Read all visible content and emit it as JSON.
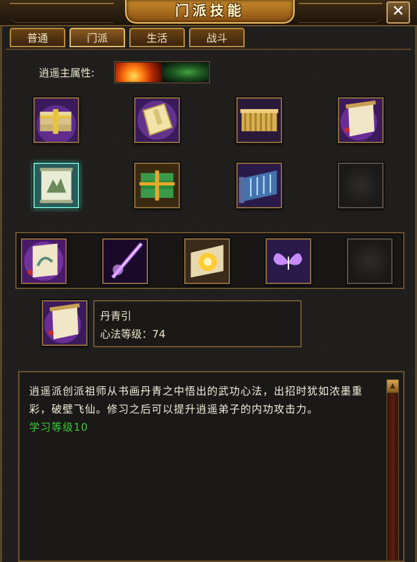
{
  "window": {
    "title": "门派技能",
    "close_label": "✕"
  },
  "tabs": [
    {
      "label": "普通",
      "active": false
    },
    {
      "label": "门派",
      "active": true
    },
    {
      "label": "生活",
      "active": false
    },
    {
      "label": "战斗",
      "active": false
    }
  ],
  "attribute": {
    "label": "逍遥主属性:",
    "icons": [
      "fire-attribute-icon",
      "wind-attribute-icon"
    ]
  },
  "skill_grid": [
    {
      "icon": "bound-books-icon"
    },
    {
      "icon": "manual-book-icon"
    },
    {
      "icon": "golden-scrolls-icon"
    },
    {
      "icon": "hanging-scroll-icon"
    },
    {
      "icon": "landscape-scroll-icon",
      "selected": true
    },
    {
      "icon": "treasure-books-icon"
    },
    {
      "icon": "water-scroll-icon"
    },
    {
      "icon": "empty-slot-icon",
      "empty": true
    }
  ],
  "equipped_skills": [
    {
      "icon": "painting-scroll-icon"
    },
    {
      "icon": "purple-bolt-icon"
    },
    {
      "icon": "gold-burst-scroll-icon"
    },
    {
      "icon": "butterfly-icon"
    },
    {
      "icon": "empty-slot-icon",
      "empty": true
    }
  ],
  "selected_skill": {
    "icon": "hanging-scroll-icon",
    "name": "丹青引",
    "level_text": "心法等级：74"
  },
  "description": {
    "text": "逍遥派创派祖师从书画丹青之中悟出的武功心法，出招时犹如浓墨重彩，破壁飞仙。修习之后可以提升逍遥弟子的内功攻击力。",
    "requirement": "学习等级10"
  },
  "colors": {
    "requirement_green": "#3ec83a",
    "gold_border": "#8a6a3a",
    "selected_border": "#6ad8c0"
  }
}
